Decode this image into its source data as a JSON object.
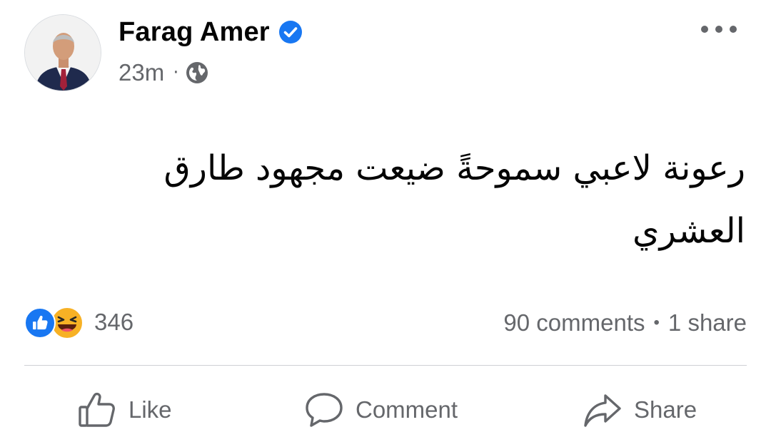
{
  "post": {
    "author": "Farag Amer",
    "verified": true,
    "timestamp": "23m",
    "separator": "·",
    "audience_icon": "globe-icon",
    "text_line1": "رعونة لاعبي سموحةً ضيعت مجهود طارق",
    "text_line2": "العشري"
  },
  "engagement": {
    "reaction_icons": [
      "like-reaction-icon",
      "haha-reaction-icon"
    ],
    "reaction_count": "346",
    "comments": "90 comments",
    "dot": "•",
    "shares": "1 share"
  },
  "actions": {
    "like": "Like",
    "comment": "Comment",
    "share": "Share"
  },
  "colors": {
    "brand_blue": "#1877f2",
    "secondary_text": "#65676b",
    "primary_text": "#050505",
    "divider": "#ced0d4",
    "haha_yellow": "#f7b125"
  }
}
